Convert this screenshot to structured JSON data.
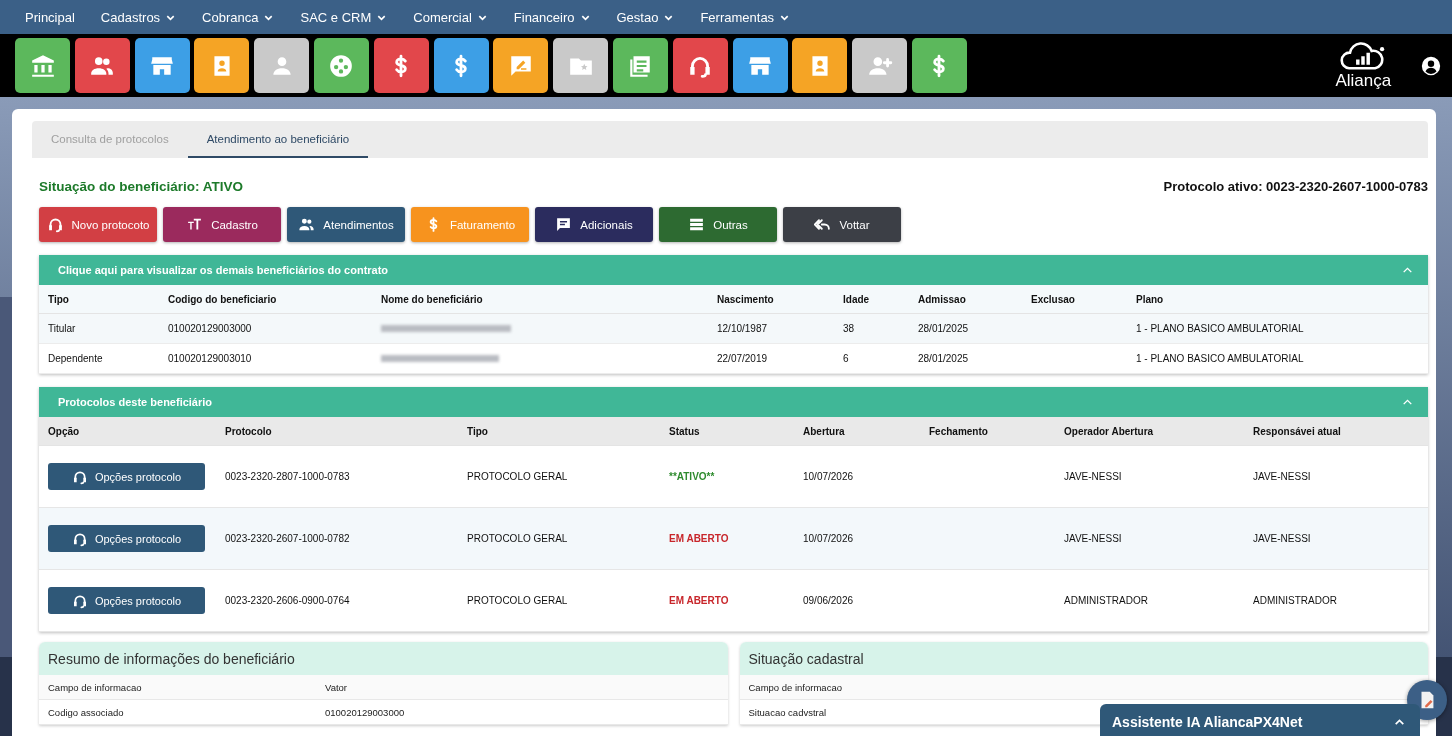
{
  "nav": [
    {
      "label": "Principal",
      "dropdown": false
    },
    {
      "label": "Cadastros",
      "dropdown": true
    },
    {
      "label": "Cobranca",
      "dropdown": true
    },
    {
      "label": "SAC e CRM",
      "dropdown": true
    },
    {
      "label": "Comercial",
      "dropdown": true
    },
    {
      "label": "Financeiro",
      "dropdown": true
    },
    {
      "label": "Gestao",
      "dropdown": true
    },
    {
      "label": "Ferramentas",
      "dropdown": true
    }
  ],
  "toolbar": [
    {
      "color": "#5cb85c"
    },
    {
      "color": "#e2474b"
    },
    {
      "color": "#3d9fe6"
    },
    {
      "color": "#f5a425"
    },
    {
      "color": "#c9c9c9"
    },
    {
      "color": "#5cb85c"
    },
    {
      "color": "#e2474b"
    },
    {
      "color": "#3d9fe6"
    },
    {
      "color": "#f5a425"
    },
    {
      "color": "#c9c9c9"
    },
    {
      "color": "#5cb85c"
    },
    {
      "color": "#e2474b"
    },
    {
      "color": "#3d9fe6"
    },
    {
      "color": "#f5a425"
    },
    {
      "color": "#c9c9c9"
    },
    {
      "color": "#5cb85c"
    }
  ],
  "logo": {
    "name": "Aliança"
  },
  "tabs": [
    {
      "label": "Consulta de protocolos",
      "selected": false
    },
    {
      "label": "Atendimento ao beneficiário",
      "selected": true
    }
  ],
  "status_line": "Situação do beneficiário: ATIVO",
  "active_protocol": "Protocolo ativo: 0023-2320-2607-1000-0783",
  "actions": [
    {
      "label": "Novo protocoto",
      "color": "#d23f44"
    },
    {
      "label": "Cadastro",
      "color": "#9b2a5d"
    },
    {
      "label": "Atendimentos",
      "color": "#2f5878"
    },
    {
      "label": "Faturamento",
      "color": "#f7931e"
    },
    {
      "label": "Adicionais",
      "color": "#2b2c5e"
    },
    {
      "label": "Outras",
      "color": "#2d6a31"
    },
    {
      "label": "Vottar",
      "color": "#3c3f46"
    }
  ],
  "beneficiaries": {
    "title": "Clique aqui para visualizar os demais beneficiários do contrato",
    "expanded": true,
    "columns": [
      "Tipo",
      "Codigo do beneficiario",
      "Nome do beneficiário",
      "Nascimento",
      "Idade",
      "Admissao",
      "Exclusao",
      "Plano"
    ],
    "rows": [
      {
        "tipo": "Titular",
        "codigo": "010020129003000",
        "nascimento": "12/10/1987",
        "idade": "38",
        "admissao": "28/01/2025",
        "plano": "1 - PLANO BASICO AMBULATORIAL"
      },
      {
        "tipo": "Dependente",
        "codigo": "010020129003010",
        "nascimento": "22/07/2019",
        "idade": "6",
        "admissao": "28/01/2025",
        "plano": "1 - PLANO BASICO AMBULATORIAL"
      }
    ]
  },
  "protocols": {
    "title": "Protocolos deste beneficiário",
    "expanded": true,
    "columns": [
      "Opção",
      "Protocolo",
      "Tipo",
      "Status",
      "Abertura",
      "Fechamento",
      "Operador Abertura",
      "Responsávei atual"
    ],
    "rows": [
      {
        "button": "Opções protocolo",
        "protocolo": "0023-2320-2807-1000-0783",
        "tipo": "PROTOCOLO GERAL",
        "status": "**ATIVO**",
        "color": "#2e8b2e",
        "abertura": "10/07/2026",
        "operador": "JAVE-NESSI",
        "responsavel": "JAVE-NESSI"
      },
      {
        "button": "Opções protocolo",
        "protocolo": "0023-2320-2607-1000-0782",
        "tipo": "PROTOCOLO GERAL",
        "status": "EM ABERTO",
        "color": "#c8262b",
        "abertura": "10/07/2026",
        "operador": "JAVE-NESSI",
        "responsavel": "JAVE-NESSI"
      },
      {
        "button": "Opções protocolo",
        "protocolo": "0023-2320-2606-0900-0764",
        "tipo": "PROTOCOLO GERAL",
        "status": "EM ABERTO",
        "color": "#c8262b",
        "abertura": "09/06/2026",
        "operador": "ADMINISTRADOR",
        "responsavel": "ADMINISTRADOR"
      }
    ]
  },
  "summary": {
    "title": "Resumo de informações do beneficiário",
    "columns": [
      "Campo de informacao",
      "Vator"
    ],
    "rows": [
      [
        "Codigo associado",
        "010020129003000"
      ]
    ]
  },
  "registration": {
    "title": "Situação cadastral",
    "columns": [
      "Campo de informacao"
    ],
    "rows": [
      [
        "Situacao cadvstral"
      ]
    ]
  },
  "assistant": {
    "title": "Assistente IA AliancaPX4Net",
    "expanded": false
  }
}
